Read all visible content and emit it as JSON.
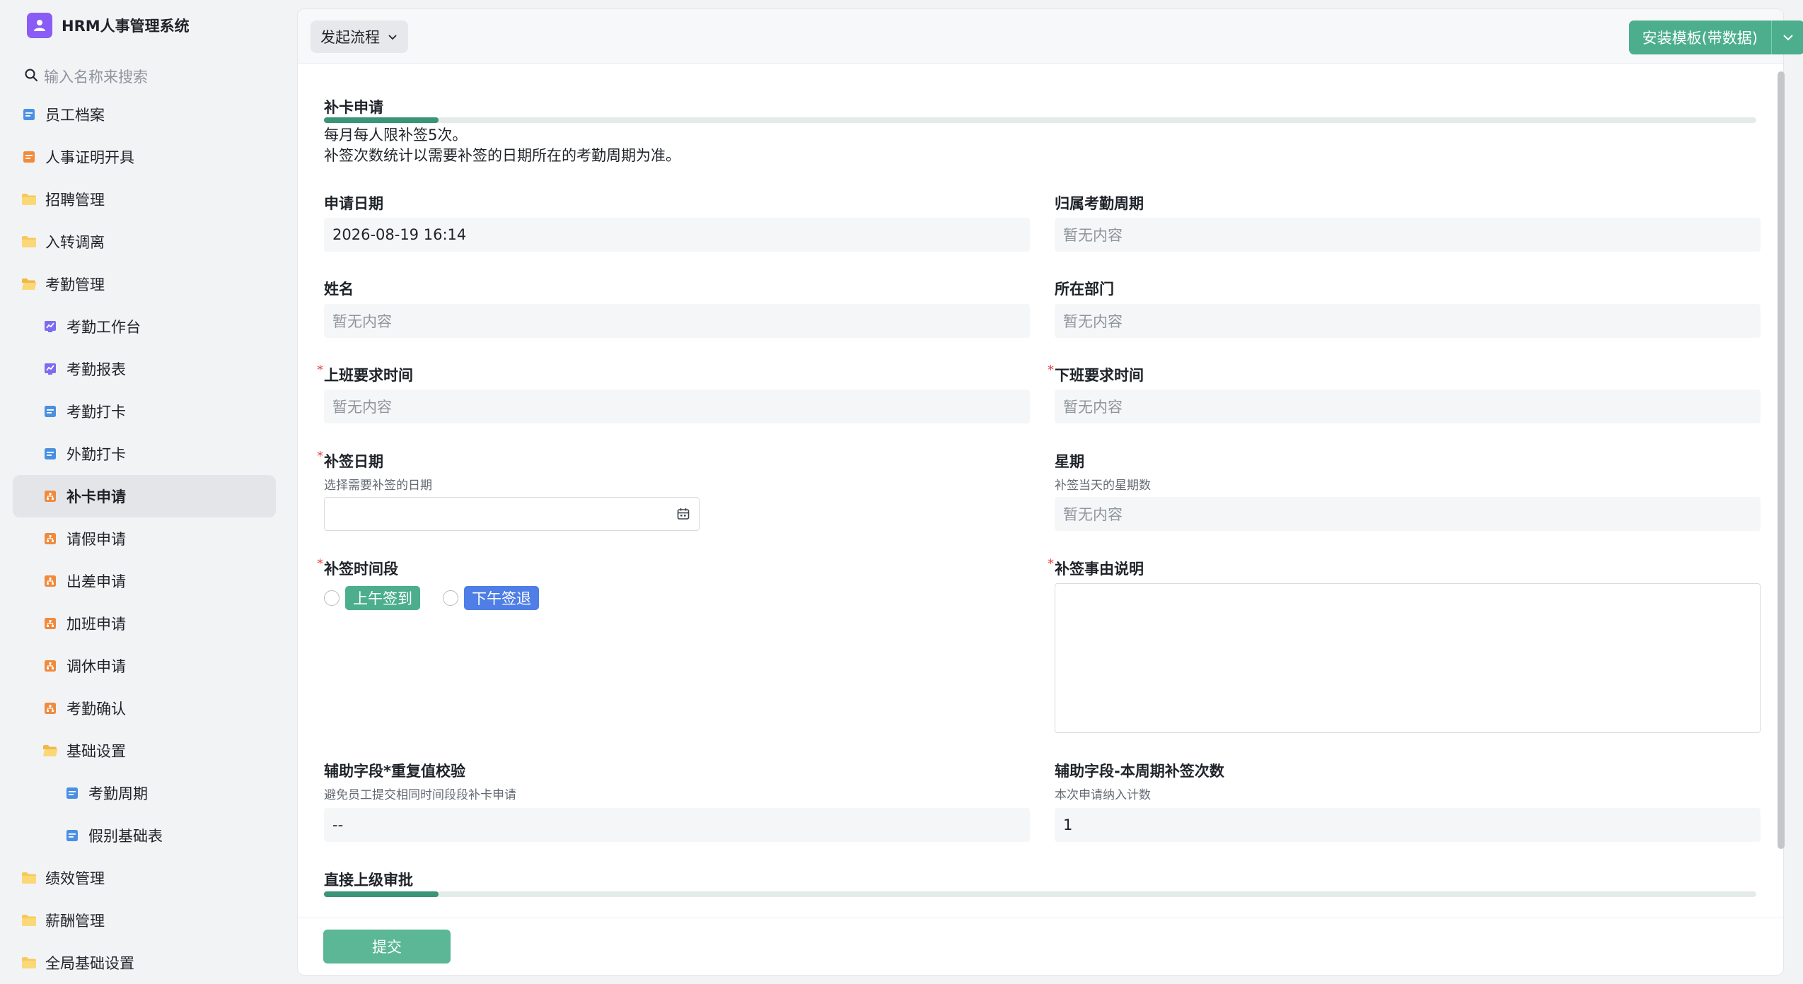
{
  "app": {
    "title": "HRM人事管理系统"
  },
  "search": {
    "placeholder": "输入名称来搜索"
  },
  "sidebar": {
    "items": [
      {
        "label": "员工档案",
        "level": 0,
        "icon": "doc-icon"
      },
      {
        "label": "人事证明开具",
        "level": 0,
        "icon": "doc-orange-icon"
      },
      {
        "label": "招聘管理",
        "level": 0,
        "icon": "folder-icon"
      },
      {
        "label": "入转调离",
        "level": 0,
        "icon": "folder-icon"
      },
      {
        "label": "考勤管理",
        "level": 0,
        "icon": "folder-open-icon"
      },
      {
        "label": "考勤工作台",
        "level": 1,
        "icon": "dashboard-icon"
      },
      {
        "label": "考勤报表",
        "level": 1,
        "icon": "dashboard-icon"
      },
      {
        "label": "考勤打卡",
        "level": 1,
        "icon": "doc-icon"
      },
      {
        "label": "外勤打卡",
        "level": 1,
        "icon": "doc-icon"
      },
      {
        "label": "补卡申请",
        "level": 1,
        "icon": "workflow-icon",
        "active": true
      },
      {
        "label": "请假申请",
        "level": 1,
        "icon": "workflow-icon"
      },
      {
        "label": "出差申请",
        "level": 1,
        "icon": "workflow-icon"
      },
      {
        "label": "加班申请",
        "level": 1,
        "icon": "workflow-icon"
      },
      {
        "label": "调休申请",
        "level": 1,
        "icon": "workflow-icon"
      },
      {
        "label": "考勤确认",
        "level": 1,
        "icon": "workflow-icon"
      },
      {
        "label": "基础设置",
        "level": 1,
        "icon": "folder-open-icon"
      },
      {
        "label": "考勤周期",
        "level": 2,
        "icon": "doc-icon"
      },
      {
        "label": "假别基础表",
        "level": 2,
        "icon": "doc-icon"
      },
      {
        "label": "绩效管理",
        "level": 0,
        "icon": "folder-icon"
      },
      {
        "label": "薪酬管理",
        "level": 0,
        "icon": "folder-icon"
      },
      {
        "label": "全局基础设置",
        "level": 0,
        "icon": "folder-icon"
      }
    ]
  },
  "toolbar": {
    "flow_label": "发起流程",
    "install_label": "安装模板(带数据)"
  },
  "form": {
    "section1_title": "补卡申请",
    "desc_line1": "每月每人限补签5次。",
    "desc_line2": "补签次数统计以需要补签的日期所在的考勤周期为准。",
    "apply_date": {
      "label": "申请日期",
      "value": "2026-08-19 16:14"
    },
    "period": {
      "label": "归属考勤周期",
      "value": "暂无内容"
    },
    "name": {
      "label": "姓名",
      "value": "暂无内容"
    },
    "dept": {
      "label": "所在部门",
      "value": "暂无内容"
    },
    "on_time": {
      "label": "上班要求时间",
      "value": "暂无内容",
      "required": true
    },
    "off_time": {
      "label": "下班要求时间",
      "value": "暂无内容",
      "required": true
    },
    "sign_date": {
      "label": "补签日期",
      "hint": "选择需要补签的日期",
      "value": "",
      "required": true
    },
    "weekday": {
      "label": "星期",
      "hint": "补签当天的星期数",
      "value": "暂无内容"
    },
    "slot": {
      "label": "补签时间段",
      "required": true,
      "options": [
        "上午签到",
        "下午签退"
      ],
      "option_colors": [
        "#4cae8c",
        "#4e7ee6"
      ]
    },
    "reason": {
      "label": "补签事由说明",
      "value": "",
      "required": true
    },
    "dup_check": {
      "label": "辅助字段*重复值校验",
      "hint": "避免员工提交相同时间段段补卡申请",
      "value": "--"
    },
    "cycle_count": {
      "label": "辅助字段-本周期补签次数",
      "hint": "本次申请纳入计数",
      "value": "1"
    },
    "section2_title": "直接上级审批"
  },
  "footer": {
    "submit_label": "提交"
  },
  "colors": {
    "accent": "#4cae8c",
    "brand": "#8a5cf6",
    "section_bar": "#3a9477"
  }
}
